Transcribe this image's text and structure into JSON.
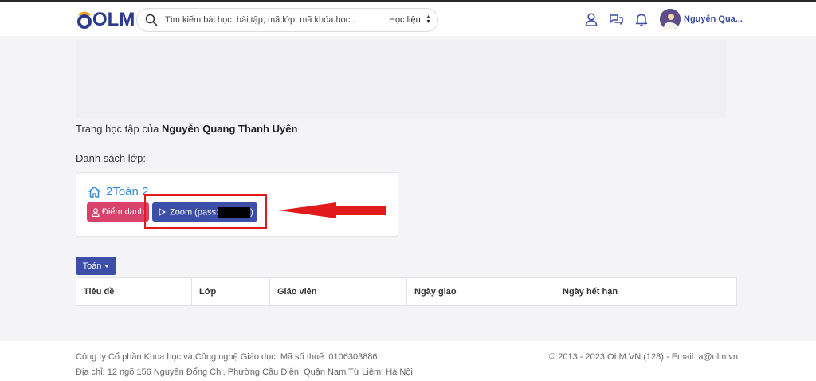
{
  "header": {
    "logo_text": "OLM",
    "search": {
      "placeholder": "Tìm kiếm bài học, bài tập, mã lớp, mã khóa học...",
      "category": "Học liệu"
    },
    "user_name": "Nguyễn Qua..."
  },
  "main": {
    "heading_prefix": "Trang học tập của",
    "heading_name": "Nguyễn Quang Thanh Uyên",
    "class_list_label": "Danh sách lớp:",
    "class_card": {
      "title": "2Toán 2",
      "attendance_label": "Điểm danh",
      "zoom_label_prefix": "Zoom (pass:",
      "zoom_label_suffix": ")"
    },
    "subject_dropdown": "Toán",
    "table_headers": [
      "Tiêu đề",
      "Lớp",
      "Giáo viên",
      "Ngày giao",
      "Ngày hết hạn"
    ]
  },
  "footer": {
    "company": "Công ty Cổ phần Khoa học và Công nghệ Giáo dục, Mã số thuế: 0106303886",
    "address": "Địa chỉ: 12 ngõ 156 Nguyễn Đổng Chi, Phường Cầu Diễn, Quận Nam Từ Liêm, Hà Nội",
    "copyright": "© 2013 - 2023 OLM.VN (128) - Email: a@olm.vn"
  },
  "colors": {
    "brand_blue": "#3d4ea8",
    "attendance_pink": "#d8426b",
    "annotation_red": "#e11b1b",
    "link_blue": "#2f8bd8"
  },
  "icons": [
    "search-icon",
    "user-icon",
    "chat-icon",
    "bell-icon",
    "home-icon",
    "person-icon",
    "play-icon"
  ]
}
